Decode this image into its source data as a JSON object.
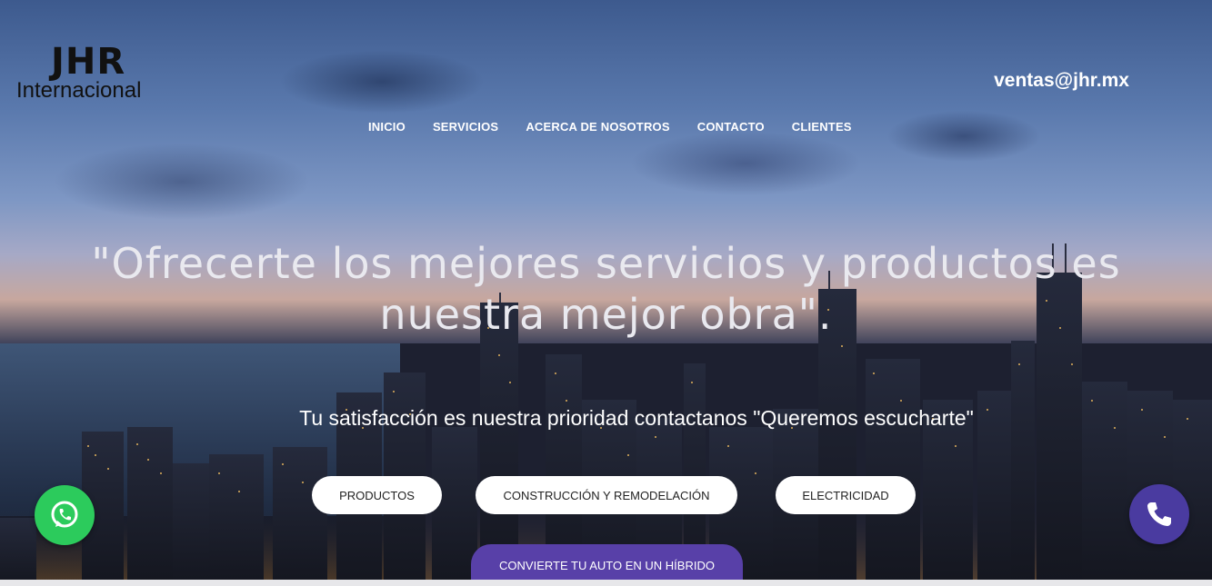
{
  "logo": {
    "title": "JHR",
    "subtitle": "Internacional"
  },
  "header": {
    "email": "ventas@jhr.mx"
  },
  "nav": {
    "items": [
      {
        "label": "INICIO"
      },
      {
        "label": "SERVICIOS"
      },
      {
        "label": "ACERCA DE NOSOTROS"
      },
      {
        "label": "CONTACTO"
      },
      {
        "label": "CLIENTES"
      }
    ]
  },
  "hero": {
    "headline_line1": "\"Ofrecerte los mejores servicios y productos es",
    "headline_line2": "nuestra mejor obra\".",
    "subline": "Tu satisfacción es nuestra prioridad contactanos \"Queremos escucharte\""
  },
  "buttons": {
    "productos": "PRODUCTOS",
    "construccion": "CONSTRUCCIÓN Y REMODELACIÓN",
    "electricidad": "ELECTRICIDAD",
    "hibrido": "CONVIERTE TU AUTO EN UN HÍBRIDO"
  },
  "floating": {
    "whatsapp_icon": "whatsapp-icon",
    "phone_icon": "phone-icon"
  },
  "colors": {
    "whatsapp": "#2ccb5c",
    "phone": "#4a3ba0",
    "accent_button": "#5840a8"
  }
}
